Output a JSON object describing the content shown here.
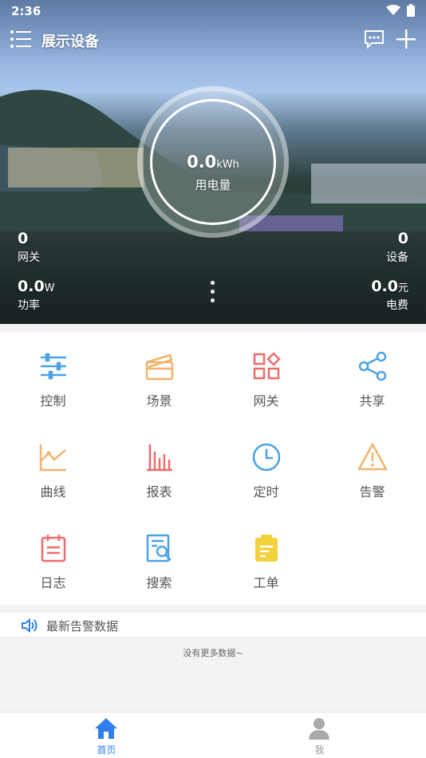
{
  "status_bar": {
    "time": "2:36"
  },
  "header": {
    "title": "展示设备"
  },
  "energy": {
    "value": "0.0",
    "unit": "kWh",
    "label": "用电量"
  },
  "stats": {
    "gateway": {
      "value": "0",
      "label": "网关"
    },
    "device": {
      "value": "0",
      "label": "设备"
    },
    "power": {
      "value": "0.0",
      "unit": "W",
      "label": "功率"
    },
    "fee": {
      "value": "0.0",
      "unit": "元",
      "label": "电费"
    }
  },
  "menu": [
    {
      "label": "控制",
      "icon": "sliders-icon",
      "color": "#4aa3e6"
    },
    {
      "label": "场景",
      "icon": "clapperboard-icon",
      "color": "#f2b36b"
    },
    {
      "label": "网关",
      "icon": "apps-icon",
      "color": "#ef6b6b"
    },
    {
      "label": "共享",
      "icon": "share-icon",
      "color": "#4aa3e6"
    },
    {
      "label": "曲线",
      "icon": "line-chart-icon",
      "color": "#f2b36b"
    },
    {
      "label": "报表",
      "icon": "bar-chart-icon",
      "color": "#ef6b6b"
    },
    {
      "label": "定时",
      "icon": "clock-icon",
      "color": "#4aa3e6"
    },
    {
      "label": "告警",
      "icon": "warning-icon",
      "color": "#f2b36b"
    },
    {
      "label": "日志",
      "icon": "calendar-icon",
      "color": "#ef6b6b"
    },
    {
      "label": "搜索",
      "icon": "search-doc-icon",
      "color": "#4aa3e6"
    },
    {
      "label": "工单",
      "icon": "clipboard-icon",
      "color": "#f2d23a"
    }
  ],
  "alarm": {
    "title": "最新告警数据",
    "empty_text": "没有更多数据~"
  },
  "bottom_nav": {
    "home": {
      "label": "首页",
      "color": "#2f80ed"
    },
    "me": {
      "label": "我",
      "color": "#999999"
    }
  }
}
